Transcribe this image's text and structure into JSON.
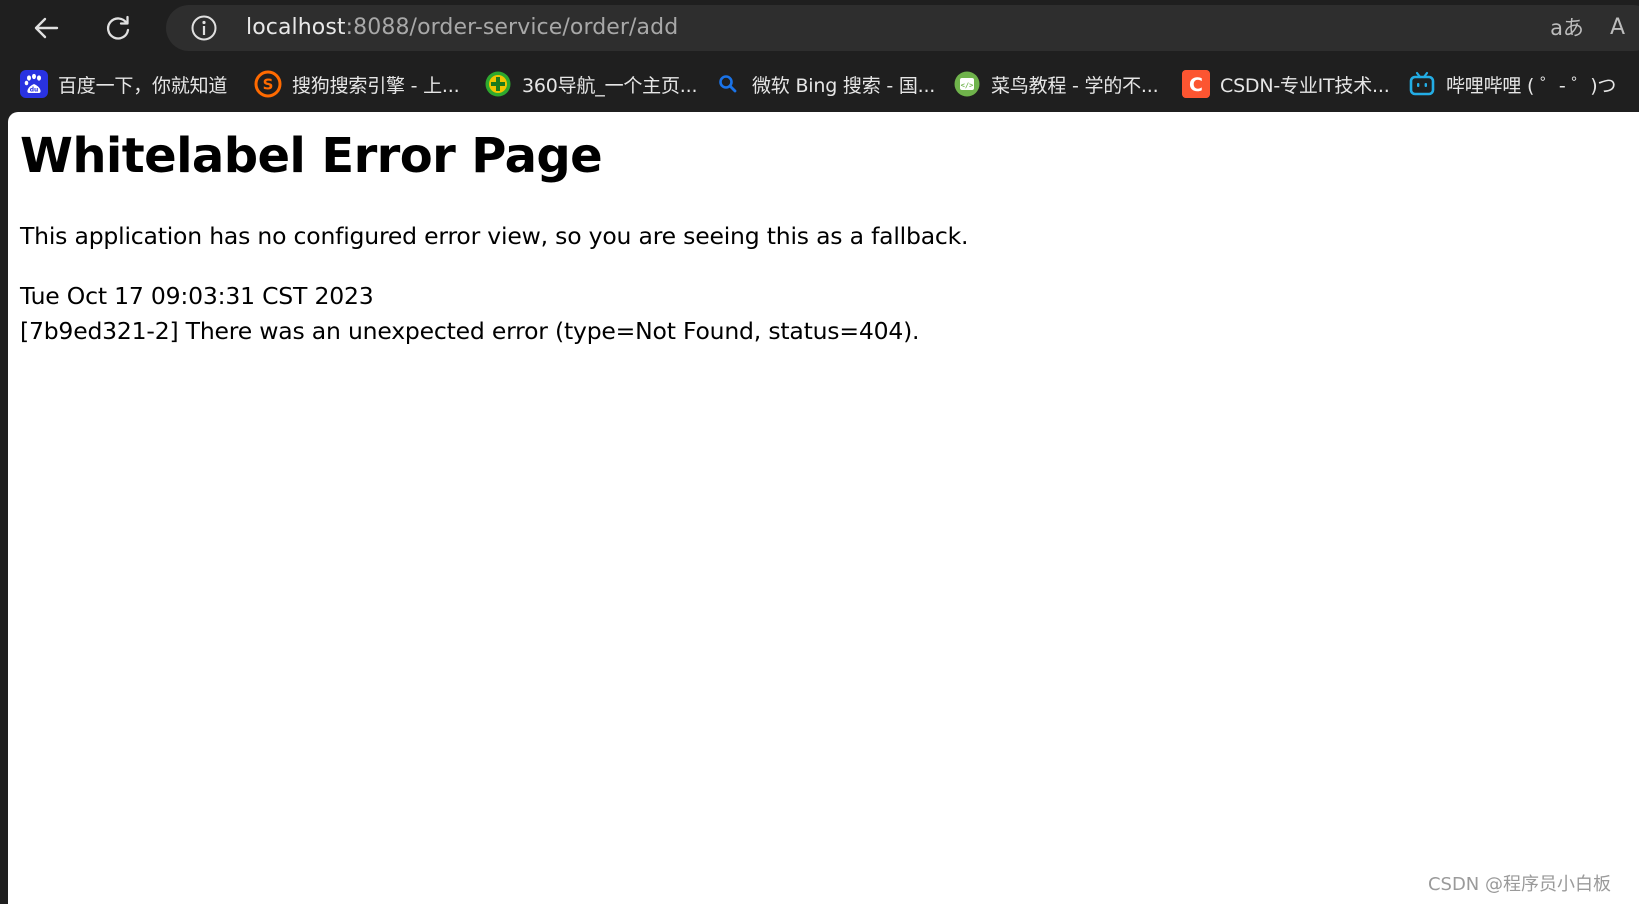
{
  "browser": {
    "url_host": "localhost",
    "url_rest": ":8088/order-service/order/add",
    "translate_glyph": "aあ",
    "reader_glyph": "A",
    "icons": {
      "back": "back-arrow-icon",
      "refresh": "refresh-icon",
      "info": "info-icon",
      "translate": "translate-icon",
      "reader": "reader-mode-icon"
    }
  },
  "favorites": [
    {
      "label": "百度一下，你就知道",
      "icon": "baidu-icon",
      "icon_text": "du",
      "color": "#2932e1"
    },
    {
      "label": "搜狗搜索引擎 - 上...",
      "icon": "sogou-icon",
      "icon_text": "S",
      "color": "#ff6a00"
    },
    {
      "label": "360导航_一个主页...",
      "icon": "360-icon",
      "icon_text": "+",
      "color": "#2ea92e"
    },
    {
      "label": "微软 Bing 搜索 - 国...",
      "icon": "bing-search-icon",
      "icon_text": "",
      "color": "#1a73e8"
    },
    {
      "label": "菜鸟教程 - 学的不...",
      "icon": "runoob-icon",
      "icon_text": "</>",
      "color": "#6fb34b"
    },
    {
      "label": "CSDN-专业IT技术...",
      "icon": "csdn-icon",
      "icon_text": "C",
      "color": "#fc5531"
    },
    {
      "label": "哔哩哔哩 ( ゜- ゜)つ",
      "icon": "bilibili-icon",
      "icon_text": "",
      "color": "#23ade5"
    }
  ],
  "page": {
    "title": "Whitelabel Error Page",
    "description": "This application has no configured error view, so you are seeing this as a fallback.",
    "timestamp": "Tue Oct 17 09:03:31 CST 2023",
    "error_line": "[7b9ed321-2] There was an unexpected error (type=Not Found, status=404)."
  },
  "watermark": "CSDN @程序员小白板"
}
